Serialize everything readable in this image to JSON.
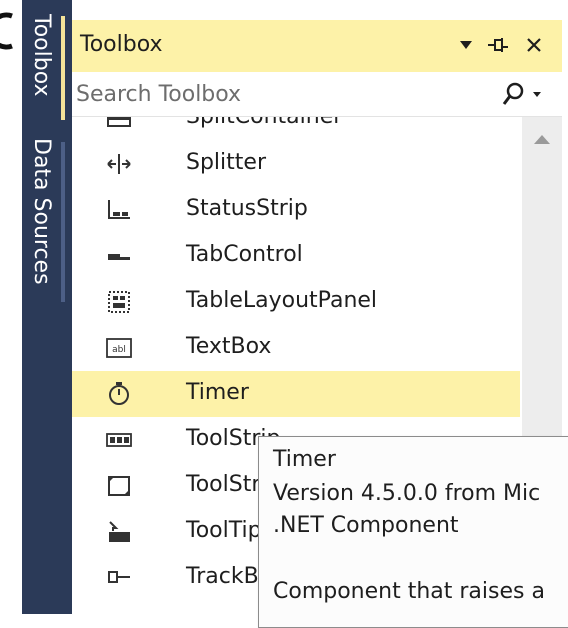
{
  "side_tabs": [
    {
      "label": "Toolbox"
    },
    {
      "label": "Data Sources"
    }
  ],
  "toolbox": {
    "title": "Toolbox",
    "search": {
      "placeholder": "Search Toolbox",
      "value": ""
    },
    "items": [
      {
        "label": "SplitContainer",
        "icon": "split-container-icon"
      },
      {
        "label": "Splitter",
        "icon": "splitter-icon"
      },
      {
        "label": "StatusStrip",
        "icon": "status-strip-icon"
      },
      {
        "label": "TabControl",
        "icon": "tab-control-icon"
      },
      {
        "label": "TableLayoutPanel",
        "icon": "table-layout-panel-icon"
      },
      {
        "label": "TextBox",
        "icon": "textbox-icon",
        "icon_text": "abl"
      },
      {
        "label": "Timer",
        "icon": "timer-icon",
        "selected": true
      },
      {
        "label": "ToolStrip",
        "icon": "toolstrip-icon"
      },
      {
        "label": "ToolStripContainer",
        "icon": "toolstrip-container-icon"
      },
      {
        "label": "ToolTip",
        "icon": "tooltip-icon"
      },
      {
        "label": "TrackBar",
        "icon": "trackbar-icon"
      }
    ]
  },
  "tooltip": {
    "title": "Timer",
    "version": "Version 4.5.0.0 from Mic",
    "kind": ".NET Component",
    "description": "Component that raises a"
  },
  "colors": {
    "strip_bg": "#2b3a58",
    "title_bg": "#fdf2a8",
    "selected_bg": "#fdf2a8",
    "accent": "#f4e39a"
  }
}
